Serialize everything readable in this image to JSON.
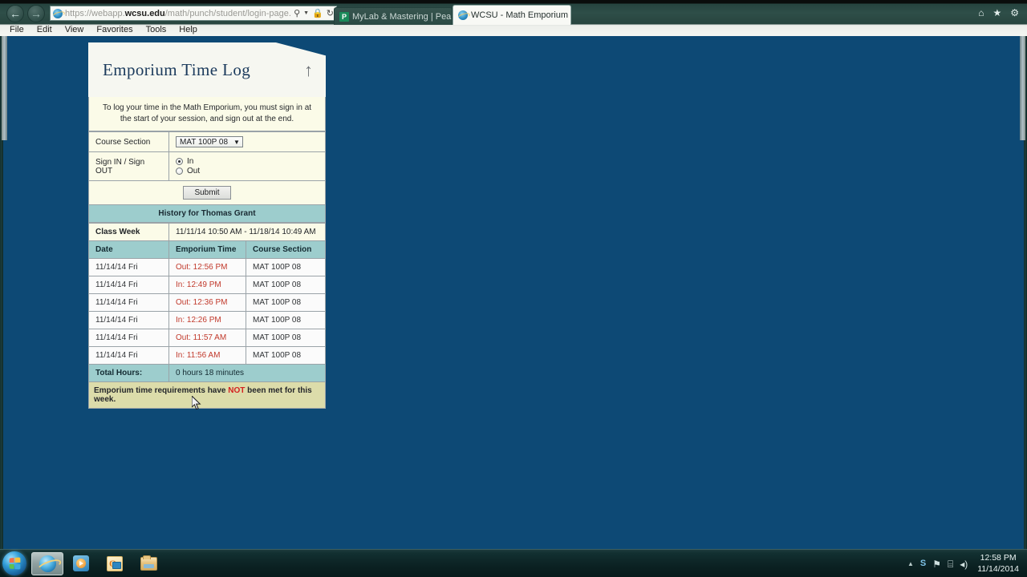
{
  "browser": {
    "back_label": "←",
    "forward_label": "→",
    "address": {
      "scheme": "https://",
      "host_prefix": "webapp.",
      "host_bold": "wcsu.edu",
      "path": "/math/punch/student/login-page.do",
      "full": "https://webapp.wcsu.edu/math/punch/student/login-page.do"
    },
    "address_icons": [
      "search-icon",
      "dropdown-caret",
      "lock-icon",
      "refresh-icon"
    ],
    "tabs": [
      {
        "label": "MyLab & Mastering | Pearson",
        "icon": "pearson-icon",
        "active": false
      },
      {
        "label": "WCSU - Math Emporium Ti...",
        "icon": "ie-icon",
        "active": true,
        "close_label": "×"
      }
    ],
    "right_icons": [
      {
        "name": "home-icon",
        "glyph": "⌂"
      },
      {
        "name": "favorites-star-icon",
        "glyph": "★"
      },
      {
        "name": "settings-gear-icon",
        "glyph": "⚙"
      }
    ],
    "menu": [
      "File",
      "Edit",
      "View",
      "Favorites",
      "Tools",
      "Help"
    ]
  },
  "page": {
    "background_color": "#0d4975",
    "title": "Emporium Time Log",
    "up_arrow_glyph": "↑",
    "instructions": "To log your time in the Math Emporium, you must sign in at the start of your session, and sign out at the end.",
    "form": {
      "course_section_label": "Course Section",
      "course_section_value": "MAT 100P 08",
      "caret_glyph": "⌄",
      "signin_label": "Sign IN / Sign OUT",
      "radio_options": [
        {
          "label": "In",
          "selected": true
        },
        {
          "label": "Out",
          "selected": false
        }
      ],
      "submit_label": "Submit"
    },
    "history": {
      "title": "History for Thomas Grant",
      "class_week_label": "Class Week",
      "class_week_value": "11/11/14 10:50 AM - 11/18/14 10:49 AM",
      "columns": [
        "Date",
        "Emporium Time",
        "Course Section"
      ],
      "rows": [
        {
          "date": "11/14/14 Fri",
          "time": "Out: 12:56 PM",
          "section": "MAT 100P 08"
        },
        {
          "date": "11/14/14 Fri",
          "time": "In: 12:49 PM",
          "section": "MAT 100P 08"
        },
        {
          "date": "11/14/14 Fri",
          "time": "Out: 12:36 PM",
          "section": "MAT 100P 08"
        },
        {
          "date": "11/14/14 Fri",
          "time": "In: 12:26 PM",
          "section": "MAT 100P 08"
        },
        {
          "date": "11/14/14 Fri",
          "time": "Out: 11:57 AM",
          "section": "MAT 100P 08"
        },
        {
          "date": "11/14/14 Fri",
          "time": "In: 11:56 AM",
          "section": "MAT 100P 08"
        }
      ],
      "total_label": "Total Hours:",
      "total_value": "0 hours 18 minutes"
    },
    "warning": {
      "before": "Emporium time requirements have ",
      "emphasis": "NOT",
      "after": " been met for this week.",
      "emphasis_color": "#d31f1f"
    }
  },
  "taskbar": {
    "start_name": "start-orb",
    "items": [
      {
        "name": "taskbar-internet-explorer",
        "icon": "ie-icon",
        "active": true
      },
      {
        "name": "taskbar-windows-media-player",
        "icon": "media-player-icon",
        "active": false
      },
      {
        "name": "taskbar-outlook",
        "icon": "outlook-icon",
        "active": false
      },
      {
        "name": "taskbar-windows-explorer",
        "icon": "folder-icon",
        "active": false
      }
    ],
    "tray": {
      "caret_glyph": "▲",
      "icons": [
        {
          "name": "lync-tray-icon",
          "glyph": "S"
        },
        {
          "name": "flag-action-center-icon",
          "glyph": "⚑"
        },
        {
          "name": "network-tray-icon",
          "glyph": "⌸"
        },
        {
          "name": "volume-tray-icon",
          "glyph": "◂)"
        }
      ],
      "time": "12:58 PM",
      "date": "11/14/2014"
    }
  }
}
